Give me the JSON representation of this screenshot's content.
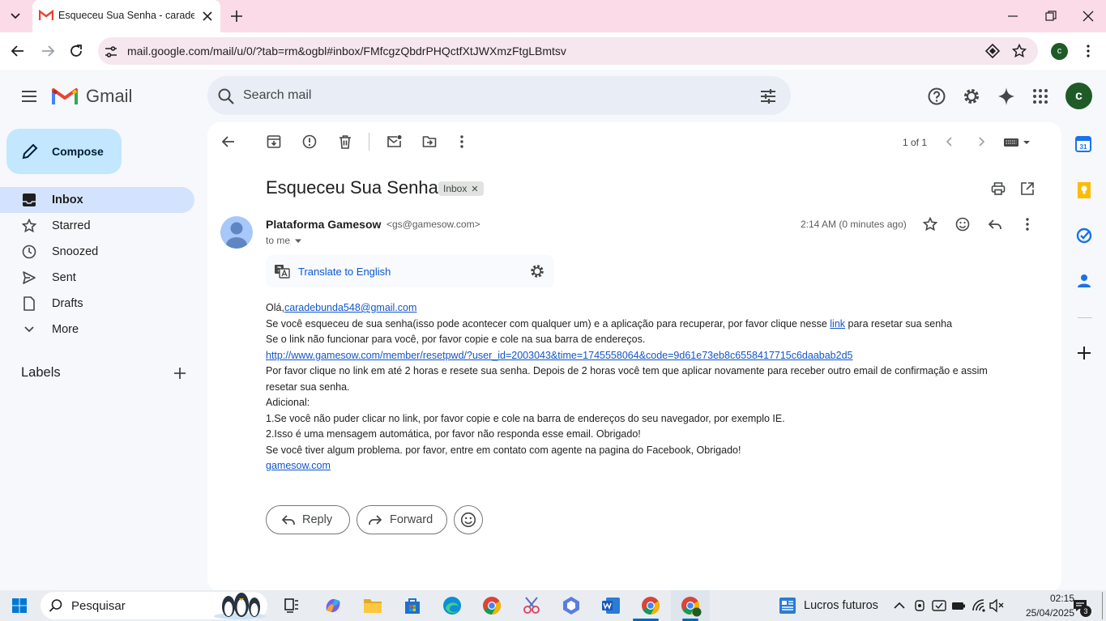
{
  "browser": {
    "tab_title": "Esqueceu Sua Senha - caradebu",
    "url": "mail.google.com/mail/u/0/?tab=rm&ogbl#inbox/FMfcgzQbdrPHQctfXtJWXmzFtgLBmtsv",
    "profile_initial": "c"
  },
  "gmail": {
    "logo_text": "Gmail",
    "search_placeholder": "Search mail",
    "avatar_initial": "c",
    "compose_label": "Compose",
    "nav": [
      {
        "label": "Inbox",
        "icon": "inbox-icon",
        "active": true
      },
      {
        "label": "Starred",
        "icon": "star-icon"
      },
      {
        "label": "Snoozed",
        "icon": "clock-icon"
      },
      {
        "label": "Sent",
        "icon": "send-icon"
      },
      {
        "label": "Drafts",
        "icon": "draft-icon"
      },
      {
        "label": "More",
        "icon": "chevron-down-icon"
      }
    ],
    "labels_heading": "Labels"
  },
  "message": {
    "pager": "1 of 1",
    "subject": "Esqueceu Sua Senha",
    "label_badge": "Inbox",
    "sender_name": "Plataforma Gamesow",
    "sender_email": "<gs@gamesow.com>",
    "to": "to me",
    "time": "2:14 AM (0 minutes ago)",
    "translate_label": "Translate to English",
    "body": {
      "greeting": "Olá,",
      "greeting_email": "caradebunda548@gmail.com",
      "line1_a": "Se você esqueceu de sua senha(isso pode acontecer com qualquer um) e a aplicação para recuperar, por favor clique nesse",
      "line1_link": "link",
      "line1_b": "para resetar sua senha",
      "line2": "Se o link não funcionar para você, por favor copie e cole na sua barra de endereços.",
      "reset_url": "http://www.gamesow.com/member/resetpwd/?user_id=2003043&time=1745558064&code=9d61e73eb8c6558417715c6daabab2d5",
      "line3a": "Por favor clique no link em até 2 horas e resete sua senha. Depois de 2 horas você tem que aplicar novamente para receber outro email de confirmação e assim",
      "line3b": "resetar sua senha.",
      "line4": "Adicional:",
      "line5": "1.Se você não puder clicar no link, por favor copie e cole na barra de endereços do seu navegador, por exemplo IE.",
      "line6": "2.Isso é uma mensagem automática, por favor não responda esse email. Obrigado!",
      "line7": "Se você tiver algum problema. por favor, entre em contato com agente na pagina do Facebook, Obrigado!",
      "footer_link": "gamesow.com"
    },
    "reply_label": "Reply",
    "forward_label": "Forward"
  },
  "taskbar": {
    "search_label": "Pesquisar",
    "widget_label": "Lucros futuros",
    "clock_time": "02:15",
    "clock_date": "25/04/2025",
    "notification_count": "3"
  },
  "colors": {
    "titlebar": "#fbdbe8",
    "compose": "#c2e7ff",
    "nav_active": "#d3e3fd",
    "link": "#1155cc",
    "gmail_red": "#ea4335"
  }
}
